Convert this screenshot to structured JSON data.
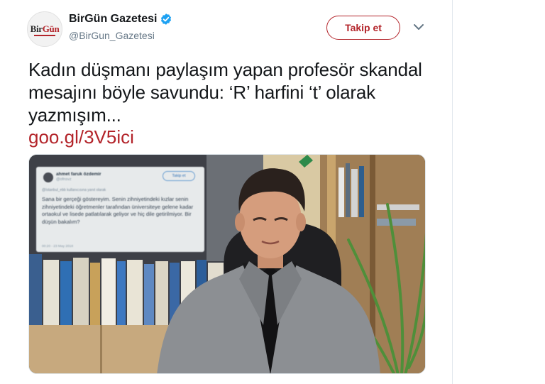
{
  "account": {
    "display_name": "BirGün Gazetesi",
    "handle": "@BirGun_Gazetesi",
    "verified": true,
    "avatar_logo": {
      "part1": "Bir",
      "part2": "Gün"
    }
  },
  "follow_button_label": "Takip et",
  "tweet": {
    "text": "Kadın düşmanı paylaşım yapan profesör skandal mesajını böyle savundu: ‘R’ harfini ‘t’ olarak yazmışım...",
    "link": "goo.gl/3V5ici"
  },
  "embedded_tweet": {
    "name": "ahmet faruk özdemir",
    "handle": "@ofnsvz",
    "follow_label": "Takip et",
    "reply_line": "@Istanbul_ebb kullanıcısına yanıt olarak",
    "body": "Sana bir gerçeği göstereyim. Senin zihniyetindeki kızlar senin zihniyetindeki öğretmenler tarafından üniversiteye gelene kadar ortaokul ve lisede patlatılarak geliyor ve hiç dile getirilmiyor. Bir düşün bakalım?",
    "time": "00:20 - 23 May 2018"
  },
  "colors": {
    "brand": "#b3242a",
    "verified": "#1da1f2",
    "text": "#14171a",
    "secondary": "#657786"
  },
  "icons": {
    "verified": "verified-badge-icon",
    "more": "chevron-down-icon"
  }
}
